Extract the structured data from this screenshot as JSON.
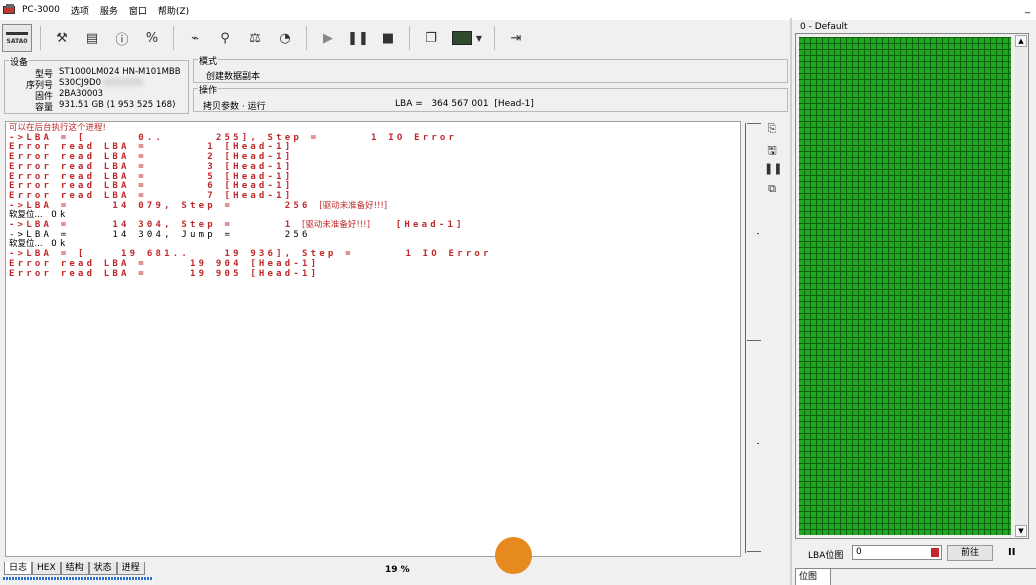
{
  "app": {
    "title": "PC-3000",
    "menu": [
      "选项",
      "服务",
      "窗口",
      "帮助(Z)"
    ],
    "minimize": "_"
  },
  "toolbar": {
    "sata_label": "SATA0"
  },
  "device": {
    "group_title": "设备",
    "rows": [
      {
        "label": "型号",
        "value": "ST1000LM024 HN-M101MBB"
      },
      {
        "label": "序列号",
        "value": "S30CJ9D0"
      },
      {
        "label": "固件",
        "value": "2BA30003"
      },
      {
        "label": "容量",
        "value": "931.51 GB (1 953 525 168)"
      }
    ]
  },
  "mode": {
    "group_title": "模式",
    "value": "创建数据副本"
  },
  "operation": {
    "group_title": "操作",
    "value": "拷贝参数 · 运行",
    "lba_text": "LBA =   364 567 001  [Head-1]"
  },
  "log": [
    {
      "c": "cn-red",
      "t": "可以在后台执行这个进程!"
    },
    {
      "c": "r",
      "t": "->LBA = [      0..      255], Step =      1 IO Error"
    },
    {
      "c": "r",
      "t": "Error read LBA =       1 [Head-1]"
    },
    {
      "c": "r",
      "t": "Error read LBA =       2 [Head-1]"
    },
    {
      "c": "r",
      "t": "Error read LBA =       3 [Head-1]"
    },
    {
      "c": "r",
      "t": "Error read LBA =       5 [Head-1]"
    },
    {
      "c": "r",
      "t": "Error read LBA =       6 [Head-1]"
    },
    {
      "c": "r",
      "t": "Error read LBA =       7 [Head-1]"
    },
    {
      "c": "r-cn",
      "t": "->LBA =     14 079, Step =      256 ",
      "cn": "[驱动未准备好!!!]"
    },
    {
      "c": "k-cn",
      "cn": "软复位...",
      "t": " Ok"
    },
    {
      "c": "r-cn2",
      "t": "->LBA =     14 304, Step =      1 ",
      "cn": "[驱动未准备好!!!]",
      "t2": "   [Head-1]"
    },
    {
      "c": "k",
      "t": "->LBA =     14 304, Jump =      256"
    },
    {
      "c": "k-cn",
      "cn": "软复位...",
      "t": " Ok"
    },
    {
      "c": "r",
      "t": "->LBA = [    19 681..    19 936], Step =      1 IO Error"
    },
    {
      "c": "r",
      "t": "Error read LBA =     19 904 [Head-1]"
    },
    {
      "c": "r",
      "t": "Error read LBA =     19 905 [Head-1]"
    }
  ],
  "tabs": [
    "日志",
    "HEX",
    "结构",
    "状态",
    "进程"
  ],
  "progress": {
    "text": "19 %",
    "value": 19
  },
  "map": {
    "title": "0 - Default",
    "lba_label": "LBA位图",
    "lba_value": "0",
    "goto": "前往",
    "pause": "II",
    "tab": "位图"
  }
}
